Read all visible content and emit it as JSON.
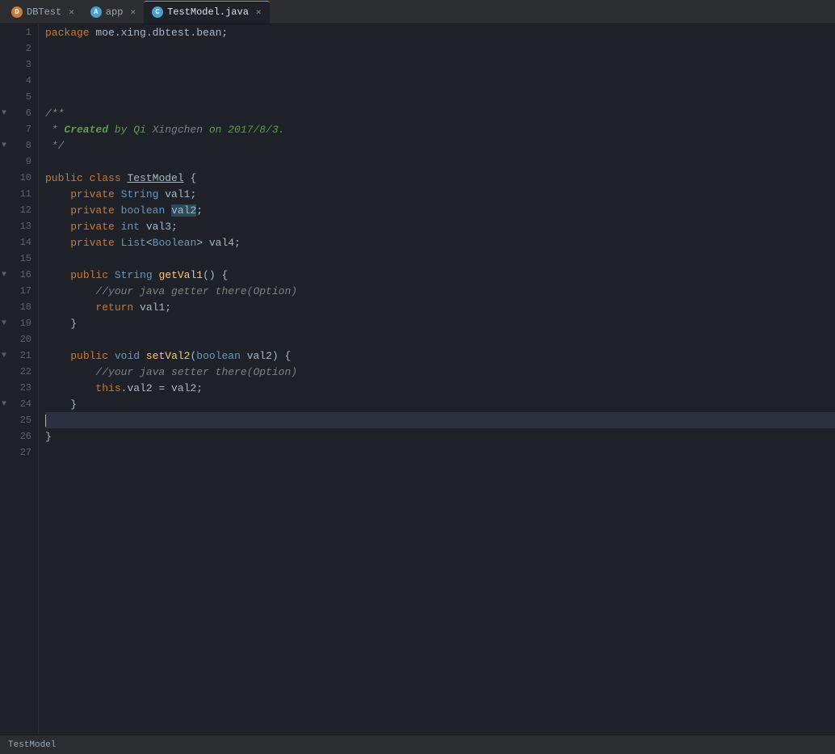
{
  "tabs": [
    {
      "id": "dbtest",
      "label": "DBTest",
      "icon": "db",
      "active": false,
      "closable": true
    },
    {
      "id": "app",
      "label": "app",
      "icon": "app",
      "active": false,
      "closable": true
    },
    {
      "id": "testmodel",
      "label": "TestModel.java",
      "icon": "java",
      "active": true,
      "closable": true
    }
  ],
  "statusBar": {
    "classLabel": "TestModel"
  },
  "colors": {
    "background": "#1e2228",
    "tabBar": "#2b2d30",
    "activeTab": "#1e2228",
    "activeTabBorder": "#4a9fce",
    "gutter": "#606366",
    "lineHeight": 20
  },
  "lines": [
    {
      "num": 1,
      "tokens": [
        {
          "t": "kw",
          "v": "package"
        },
        {
          "t": "gray",
          "v": " moe.xing.dbtest.bean;"
        }
      ]
    },
    {
      "num": 2,
      "tokens": []
    },
    {
      "num": 3,
      "tokens": []
    },
    {
      "num": 4,
      "tokens": []
    },
    {
      "num": 5,
      "tokens": []
    },
    {
      "num": 6,
      "tokens": [
        {
          "t": "fold",
          "v": "▼"
        },
        {
          "t": "comment",
          "v": "/**"
        }
      ]
    },
    {
      "num": 7,
      "tokens": [
        {
          "t": "comment",
          "v": " * "
        },
        {
          "t": "comment-tag",
          "v": "Created"
        },
        {
          "t": "green-italic",
          "v": " by Qi "
        },
        {
          "t": "comment",
          "v": "Xingchen"
        },
        {
          "t": "green-italic",
          "v": " on 2017/8/3."
        }
      ]
    },
    {
      "num": 8,
      "tokens": [
        {
          "t": "fold",
          "v": "▼"
        },
        {
          "t": "comment",
          "v": " */"
        }
      ]
    },
    {
      "num": 9,
      "tokens": []
    },
    {
      "num": 10,
      "tokens": [
        {
          "t": "kw",
          "v": "public"
        },
        {
          "t": "gray",
          "v": " "
        },
        {
          "t": "kw",
          "v": "class"
        },
        {
          "t": "gray",
          "v": " "
        },
        {
          "t": "class-name",
          "v": "TestModel"
        },
        {
          "t": "gray",
          "v": " {"
        }
      ]
    },
    {
      "num": 11,
      "tokens": [
        {
          "t": "gray",
          "v": "    "
        },
        {
          "t": "kw",
          "v": "private"
        },
        {
          "t": "gray",
          "v": " "
        },
        {
          "t": "type",
          "v": "String"
        },
        {
          "t": "gray",
          "v": " val1;"
        }
      ]
    },
    {
      "num": 12,
      "tokens": [
        {
          "t": "gray",
          "v": "    "
        },
        {
          "t": "kw",
          "v": "private"
        },
        {
          "t": "gray",
          "v": " "
        },
        {
          "t": "type",
          "v": "boolean"
        },
        {
          "t": "gray",
          "v": " "
        },
        {
          "t": "highlight-sel",
          "v": "val2"
        },
        {
          "t": "gray",
          "v": ";"
        }
      ]
    },
    {
      "num": 13,
      "tokens": [
        {
          "t": "gray",
          "v": "    "
        },
        {
          "t": "kw",
          "v": "private"
        },
        {
          "t": "gray",
          "v": " "
        },
        {
          "t": "type",
          "v": "int"
        },
        {
          "t": "gray",
          "v": " val3;"
        }
      ]
    },
    {
      "num": 14,
      "tokens": [
        {
          "t": "gray",
          "v": "    "
        },
        {
          "t": "kw",
          "v": "private"
        },
        {
          "t": "gray",
          "v": " "
        },
        {
          "t": "type",
          "v": "List"
        },
        {
          "t": "gray",
          "v": "<"
        },
        {
          "t": "type",
          "v": "Boolean"
        },
        {
          "t": "gray",
          "v": "> val4;"
        }
      ]
    },
    {
      "num": 15,
      "tokens": []
    },
    {
      "num": 16,
      "tokens": [
        {
          "t": "fold",
          "v": "▼"
        },
        {
          "t": "gray",
          "v": "    "
        },
        {
          "t": "kw",
          "v": "public"
        },
        {
          "t": "gray",
          "v": " "
        },
        {
          "t": "type",
          "v": "String"
        },
        {
          "t": "gray",
          "v": " "
        },
        {
          "t": "method",
          "v": "getVal1"
        },
        {
          "t": "gray",
          "v": "() {"
        }
      ]
    },
    {
      "num": 17,
      "tokens": [
        {
          "t": "gray",
          "v": "        "
        },
        {
          "t": "comment",
          "v": "//your java getter there(Option)"
        }
      ]
    },
    {
      "num": 18,
      "tokens": [
        {
          "t": "gray",
          "v": "        "
        },
        {
          "t": "kw",
          "v": "return"
        },
        {
          "t": "gray",
          "v": " val1;"
        }
      ]
    },
    {
      "num": 19,
      "tokens": [
        {
          "t": "fold",
          "v": "▼"
        },
        {
          "t": "gray",
          "v": "    }"
        }
      ]
    },
    {
      "num": 20,
      "tokens": []
    },
    {
      "num": 21,
      "tokens": [
        {
          "t": "fold",
          "v": "▼"
        },
        {
          "t": "gray",
          "v": "    "
        },
        {
          "t": "kw",
          "v": "public"
        },
        {
          "t": "gray",
          "v": " "
        },
        {
          "t": "type",
          "v": "void"
        },
        {
          "t": "gray",
          "v": " "
        },
        {
          "t": "method",
          "v": "setVal2"
        },
        {
          "t": "gray",
          "v": "("
        },
        {
          "t": "type",
          "v": "boolean"
        },
        {
          "t": "gray",
          "v": " val2) {"
        }
      ]
    },
    {
      "num": 22,
      "tokens": [
        {
          "t": "gray",
          "v": "        "
        },
        {
          "t": "comment",
          "v": "//your java setter there(Option)"
        }
      ]
    },
    {
      "num": 23,
      "tokens": [
        {
          "t": "gray",
          "v": "        "
        },
        {
          "t": "kw",
          "v": "this"
        },
        {
          "t": "gray",
          "v": ".val2 = val2;"
        }
      ]
    },
    {
      "num": 24,
      "tokens": [
        {
          "t": "fold",
          "v": "▼"
        },
        {
          "t": "gray",
          "v": "    }"
        }
      ]
    },
    {
      "num": 25,
      "tokens": [
        {
          "t": "cursor",
          "v": ""
        }
      ]
    },
    {
      "num": 26,
      "tokens": [
        {
          "t": "gray",
          "v": "}"
        }
      ]
    },
    {
      "num": 27,
      "tokens": []
    }
  ]
}
